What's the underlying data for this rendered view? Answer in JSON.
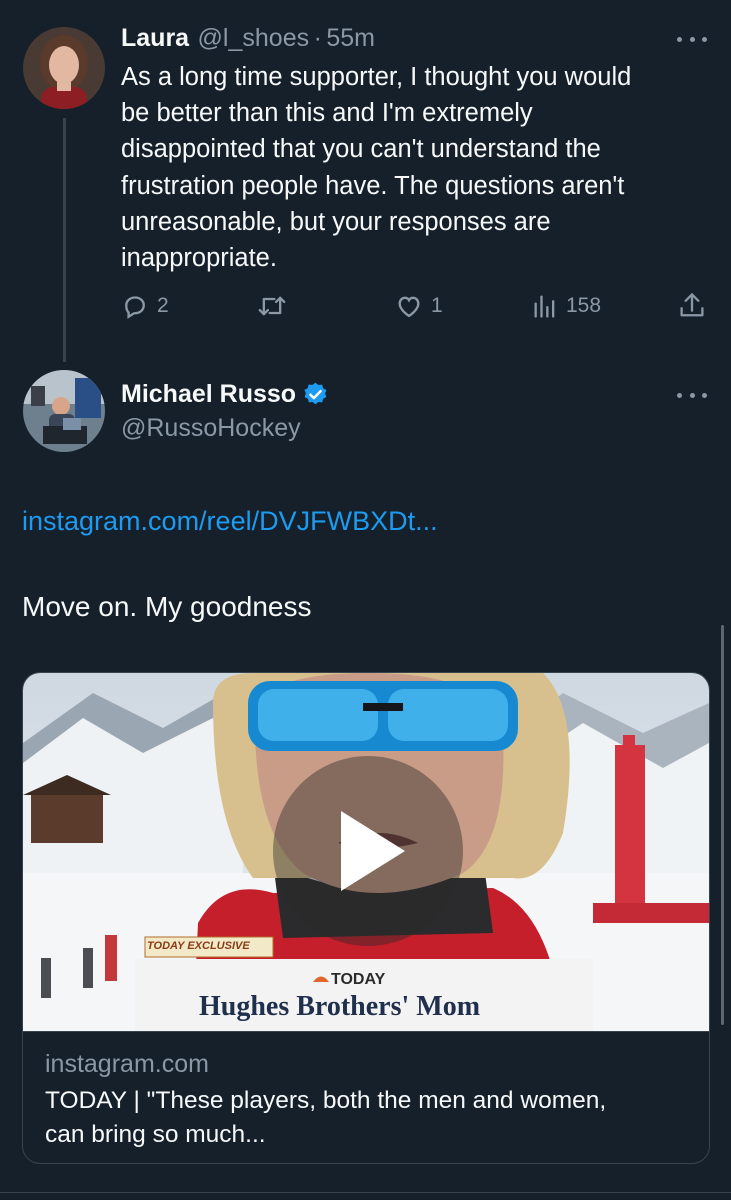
{
  "reply_tweet": {
    "author_name": "Laura",
    "handle": "@l_shoes",
    "separator": "·",
    "time": "55m",
    "lines": [
      "As a long time supporter, I thought you would",
      "be better than this and I'm extremely",
      "disappointed that you can't understand the",
      "frustration people have. The questions aren't",
      "unreasonable, but your responses are",
      "inappropriate."
    ],
    "reply_count": "2",
    "like_count": "1",
    "view_count": "158"
  },
  "main_tweet": {
    "author_name": "Michael Russo",
    "handle": "@RussoHockey",
    "link_text": "instagram.com/reel/DVJFWBXDt...",
    "body": "Move on. My goodness",
    "card": {
      "domain": "instagram.com",
      "title_line1": "TODAY | \"These players, both the men and women,",
      "title_line2": "can bring so much...",
      "overlay_exclusive": "TODAY EXCLUSIVE",
      "overlay_brand": "TODAY",
      "overlay_headline": "Hughes Brothers' Mom"
    }
  },
  "colors": {
    "background": "#15202b",
    "link": "#1d9bf0",
    "verified": "#1d9bf0",
    "muted": "#8b98a5",
    "divider": "#38444d"
  },
  "icons": [
    "more-icon",
    "reply-icon",
    "retweet-icon",
    "like-icon",
    "views-icon",
    "share-icon",
    "verified-icon",
    "play-icon"
  ]
}
